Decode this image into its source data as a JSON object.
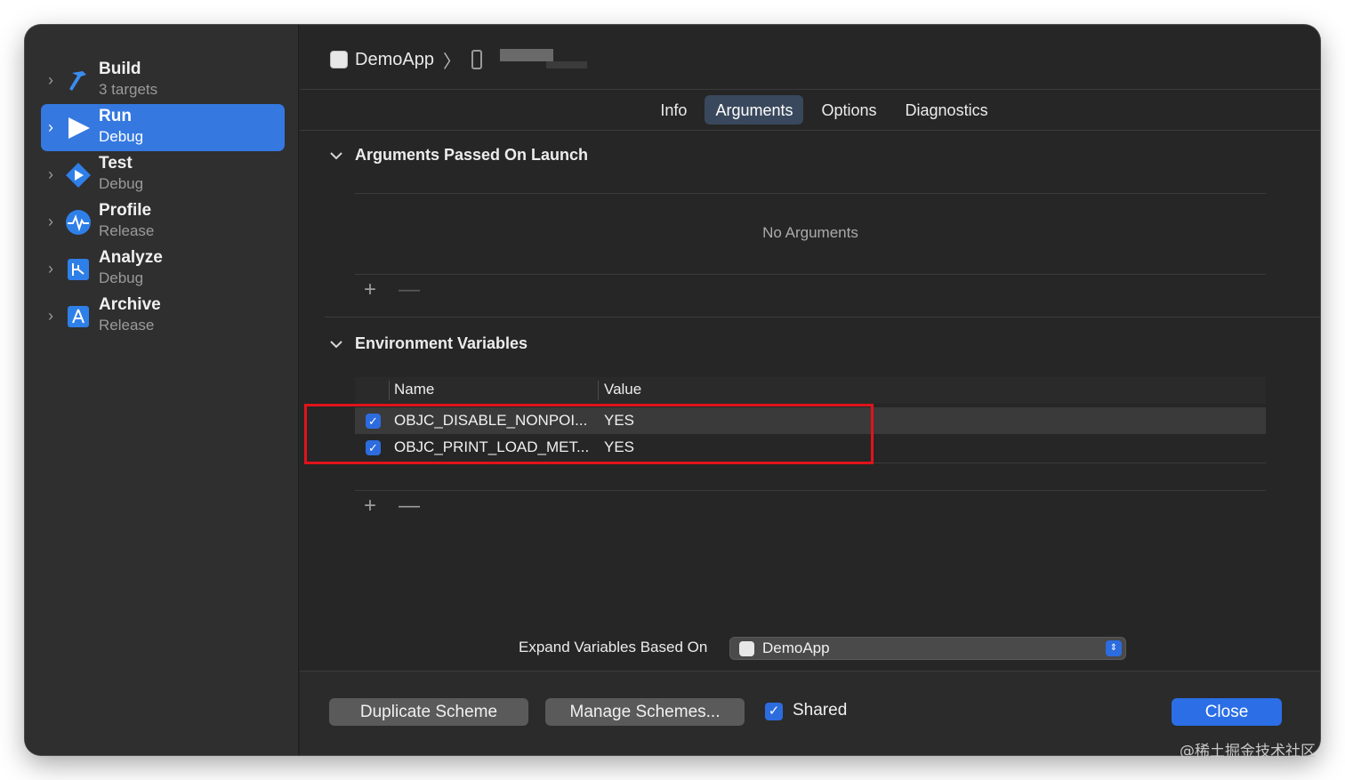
{
  "sidebar": {
    "items": [
      {
        "title": "Build",
        "subtitle": "3 targets",
        "icon": "hammer-icon",
        "selected": false
      },
      {
        "title": "Run",
        "subtitle": "Debug",
        "icon": "play-icon",
        "selected": true
      },
      {
        "title": "Test",
        "subtitle": "Debug",
        "icon": "test-diamond-icon",
        "selected": false
      },
      {
        "title": "Profile",
        "subtitle": "Release",
        "icon": "waveform-icon",
        "selected": false
      },
      {
        "title": "Analyze",
        "subtitle": "Debug",
        "icon": "analyze-icon",
        "selected": false
      },
      {
        "title": "Archive",
        "subtitle": "Release",
        "icon": "archive-icon",
        "selected": false
      }
    ]
  },
  "breadcrumb": {
    "scheme": "DemoApp",
    "separator": "〉"
  },
  "tabs": [
    {
      "label": "Info",
      "active": false
    },
    {
      "label": "Arguments",
      "active": true
    },
    {
      "label": "Options",
      "active": false
    },
    {
      "label": "Diagnostics",
      "active": false
    }
  ],
  "arguments": {
    "title": "Arguments Passed On Launch",
    "empty_text": "No Arguments",
    "add": "+",
    "remove": "—"
  },
  "environment": {
    "title": "Environment Variables",
    "columns": {
      "name": "Name",
      "value": "Value"
    },
    "rows": [
      {
        "enabled": true,
        "name": "OBJC_DISABLE_NONPOI...",
        "value": "YES"
      },
      {
        "enabled": true,
        "name": "OBJC_PRINT_LOAD_MET...",
        "value": "YES"
      }
    ],
    "add": "+",
    "remove": "—"
  },
  "expand": {
    "label": "Expand Variables Based On",
    "selected": "DemoApp"
  },
  "footer": {
    "duplicate": "Duplicate Scheme",
    "manage": "Manage Schemes...",
    "shared_label": "Shared",
    "shared_checked": true,
    "close": "Close"
  },
  "watermark": "@稀土掘金技术社区",
  "colors": {
    "accent": "#2b6ee6",
    "highlight_box": "#e0131b",
    "selected_row": "#3478e0"
  }
}
